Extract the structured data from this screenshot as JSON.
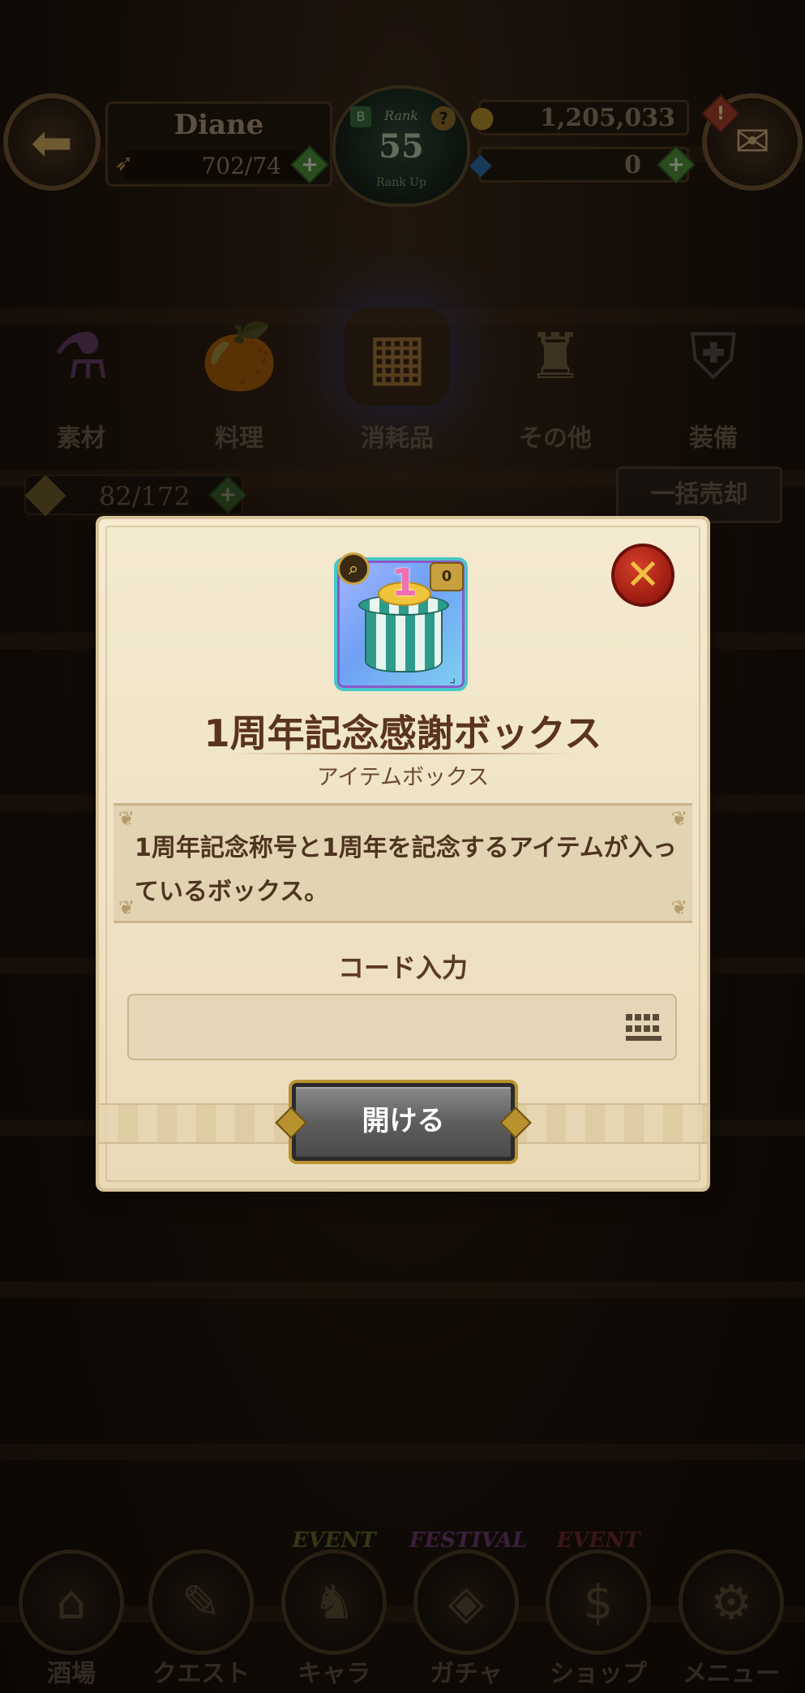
{
  "header": {
    "player_name": "Diane",
    "stamina": "702/74",
    "rank_label": "Rank",
    "rank": "55",
    "rank_sub": "Rank Up",
    "rank_badge_letter": "B",
    "rank_help": "?",
    "gold": "1,205,033",
    "gems": "0",
    "mail_alert": "!"
  },
  "categories": [
    {
      "label": "素材",
      "icon": "materials-icon",
      "active": false
    },
    {
      "label": "料理",
      "icon": "food-icon",
      "active": false
    },
    {
      "label": "消耗品",
      "icon": "consumables-icon",
      "active": true
    },
    {
      "label": "その他",
      "icon": "other-icon",
      "active": false
    },
    {
      "label": "装備",
      "icon": "equipment-icon",
      "active": false
    }
  ],
  "inventory": {
    "count": "82/172",
    "sell_all_label": "一括売却"
  },
  "bottom_nav": [
    {
      "label": "酒場",
      "tag": ""
    },
    {
      "label": "クエスト",
      "tag": ""
    },
    {
      "label": "キャラ",
      "tag": "EVENT"
    },
    {
      "label": "ガチャ",
      "tag": "FESTIVAL"
    },
    {
      "label": "ショップ",
      "tag": "EVENT"
    },
    {
      "label": "メニュー",
      "tag": ""
    }
  ],
  "modal": {
    "item_number": "1",
    "lock_badge": "0",
    "item_title": "1周年記念感謝ボックス",
    "item_category": "アイテムボックス",
    "description": "1周年記念称号と1周年を記念するアイテムが入っているボックス。",
    "code_label": "コード入力",
    "code_value": "",
    "code_placeholder": "",
    "open_button": "開ける"
  },
  "colors": {
    "modal_bg": "#f4ead0",
    "title_text": "#5a3420",
    "close_button": "#a42014",
    "open_button": "#5e5e5e",
    "accent_gold": "#b8922e"
  }
}
